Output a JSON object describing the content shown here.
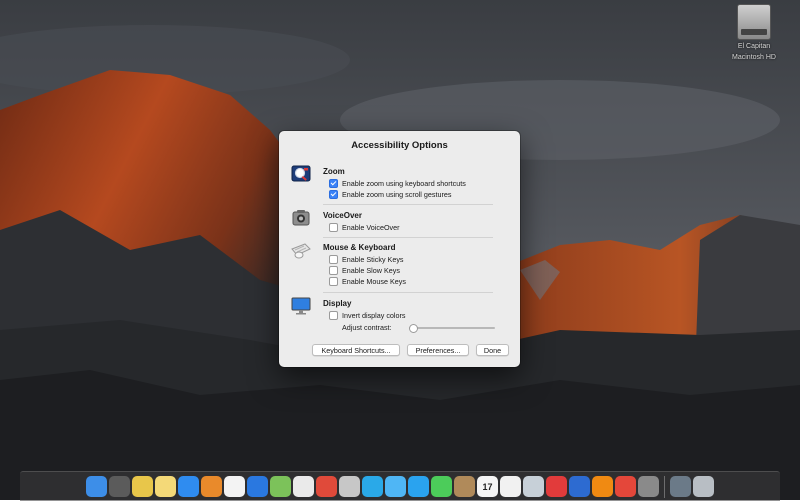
{
  "desktop": {
    "drive_label_line1": "El Capitan",
    "drive_label_line2": "Macintosh HD"
  },
  "dialog": {
    "title": "Accessibility Options",
    "sections": {
      "zoom": {
        "title": "Zoom",
        "icon": "magnifier-icon",
        "options": [
          {
            "label": "Enable zoom using keyboard shortcuts",
            "checked": true
          },
          {
            "label": "Enable zoom using scroll gestures",
            "checked": true
          }
        ]
      },
      "voiceover": {
        "title": "VoiceOver",
        "icon": "voiceover-icon",
        "options": [
          {
            "label": "Enable VoiceOver",
            "checked": false
          }
        ]
      },
      "mouse_keyboard": {
        "title": "Mouse & Keyboard",
        "icon": "keyboard-mouse-icon",
        "options": [
          {
            "label": "Enable Sticky Keys",
            "checked": false
          },
          {
            "label": "Enable Slow Keys",
            "checked": false
          },
          {
            "label": "Enable Mouse Keys",
            "checked": false
          }
        ]
      },
      "display": {
        "title": "Display",
        "icon": "display-icon",
        "options": [
          {
            "label": "Invert display colors",
            "checked": false
          }
        ],
        "contrast_label": "Adjust contrast:",
        "contrast_value": 0
      }
    },
    "buttons": {
      "keyboard_shortcuts": "Keyboard Shortcuts...",
      "preferences": "Preferences...",
      "done": "Done"
    }
  },
  "dock": {
    "items": [
      {
        "name": "finder-icon",
        "color": "#3d8ee8"
      },
      {
        "name": "launchpad-icon",
        "color": "#5b5b5b"
      },
      {
        "name": "stickies-icon",
        "color": "#e8c64a"
      },
      {
        "name": "notes-icon",
        "color": "#f4d978"
      },
      {
        "name": "app-store-icon",
        "color": "#2f8cf0"
      },
      {
        "name": "ibooks-icon",
        "color": "#e98a2b"
      },
      {
        "name": "photos-icon",
        "color": "#f3f3f3"
      },
      {
        "name": "safari-icon",
        "color": "#2a78e0"
      },
      {
        "name": "maps-icon",
        "color": "#7cc25a"
      },
      {
        "name": "clock-icon",
        "color": "#eaeaea"
      },
      {
        "name": "chrome-icon",
        "color": "#e04a3a"
      },
      {
        "name": "scrivener-icon",
        "color": "#c7c7c7"
      },
      {
        "name": "skype-icon",
        "color": "#2aa9e8"
      },
      {
        "name": "messages-icon",
        "color": "#4fb6f5"
      },
      {
        "name": "twitter-icon",
        "color": "#2aa3ef"
      },
      {
        "name": "facetime-icon",
        "color": "#4ccc5a"
      },
      {
        "name": "contacts-icon",
        "color": "#b08a5a"
      },
      {
        "name": "calendar-icon",
        "color": "#f5f5f5"
      },
      {
        "name": "reminders-icon",
        "color": "#f1f1f1"
      },
      {
        "name": "mail-icon",
        "color": "#c7d0d8"
      },
      {
        "name": "airmail-icon",
        "color": "#e23b3b"
      },
      {
        "name": "1password-icon",
        "color": "#2d6bd1"
      },
      {
        "name": "vlc-icon",
        "color": "#f08a12"
      },
      {
        "name": "infuse-icon",
        "color": "#e4473a"
      },
      {
        "name": "system-preferences-icon",
        "color": "#8a8a8a"
      },
      {
        "name": "downloads-folder-icon",
        "color": "#6b7a88"
      },
      {
        "name": "trash-icon",
        "color": "#b8bec4"
      }
    ],
    "calendar_day": "17"
  }
}
